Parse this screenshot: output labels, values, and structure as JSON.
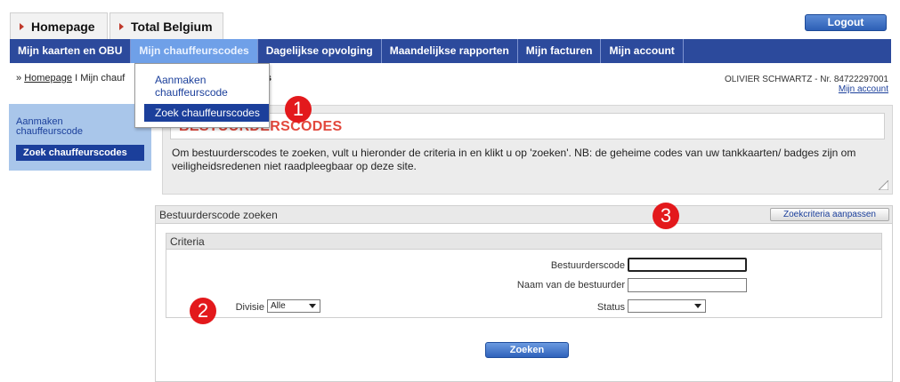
{
  "top": {
    "tabs": [
      {
        "label": "Homepage"
      },
      {
        "label": "Total Belgium"
      }
    ],
    "logout_label": "Logout"
  },
  "nav": {
    "items": [
      {
        "label": "Mijn kaarten en OBU"
      },
      {
        "label": "Mijn chauffeurscodes",
        "active": true
      },
      {
        "label": "Dagelijkse opvolging"
      },
      {
        "label": "Maandelijkse rapporten"
      },
      {
        "label": "Mijn facturen"
      },
      {
        "label": "Mijn account"
      }
    ]
  },
  "breadcrumb": {
    "home": "Homepage",
    "sep": "I",
    "current_partial": "Mijn chauf",
    "current_tail": "des"
  },
  "user": {
    "name_line": "OLIVIER SCHWARTZ - Nr. 84722297001",
    "my_account": "Mijn account"
  },
  "dropdown": {
    "items": [
      {
        "label": "Aanmaken chauffeurscode"
      },
      {
        "label": "Zoek chauffeurscodes",
        "active": true
      }
    ]
  },
  "sidebar": {
    "items": [
      {
        "label": "Aanmaken chauffeurscode"
      },
      {
        "label": "Zoek chauffeurscodes",
        "active": true
      }
    ]
  },
  "intro": {
    "title": "BESTUURDERSCODES",
    "text": "Om bestuurderscodes te zoeken, vult u hieronder de criteria in en klikt u op 'zoeken'. NB: de geheime codes van uw tankkaarten/ badges zijn om veiligheidsredenen niet raadpleegbaar op deze site."
  },
  "search": {
    "title": "Bestuurderscode zoeken",
    "adjust_label": "Zoekcriteria aanpassen",
    "criteria_title": "Criteria",
    "fields": {
      "code_label": "Bestuurderscode",
      "code_value": "",
      "name_label": "Naam van de bestuurder",
      "name_value": "",
      "divisie_label": "Divisie",
      "divisie_value": "Alle",
      "status_label": "Status",
      "status_value": ""
    },
    "submit_label": "Zoeken"
  },
  "markers": [
    "1",
    "2",
    "3"
  ],
  "colors": {
    "nav_bg": "#2c4a9c",
    "nav_active": "#6fa0e8",
    "title_red": "#e2483c",
    "marker_red": "#e3191c",
    "link_blue": "#1b3f9b"
  }
}
